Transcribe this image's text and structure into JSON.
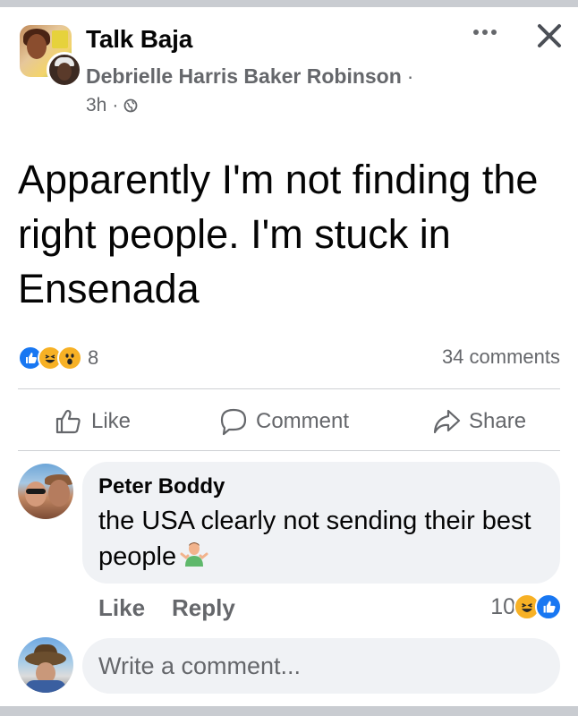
{
  "post": {
    "group_name": "Talk Baja",
    "author": "Debrielle Harris Baker Robinson",
    "author_separator": "·",
    "time": "3h",
    "time_separator": "·",
    "audience_icon": "globe-icon",
    "text": "Apparently I'm not finding the right people. I'm stuck in Ensenada"
  },
  "header_icons": {
    "more": "more-options-icon",
    "close": "close-icon"
  },
  "stats": {
    "reactions": [
      "like",
      "haha",
      "wow"
    ],
    "reaction_count": "8",
    "comments": "34 comments"
  },
  "actions": {
    "like": "Like",
    "comment": "Comment",
    "share": "Share"
  },
  "comment": {
    "author": "Peter Boddy",
    "text": "the USA clearly not sending their best people",
    "emoji": "person-shrugging-icon",
    "like_label": "Like",
    "reply_label": "Reply",
    "reaction_count": "10",
    "reactions": [
      "haha",
      "like"
    ]
  },
  "composer": {
    "placeholder": "Write a comment..."
  },
  "colors": {
    "like_blue": "#1877f2",
    "reaction_yellow": "#f7b125",
    "secondary_text": "#65676b",
    "bubble_bg": "#f0f2f5",
    "separator_bar": "#c9ccd1"
  }
}
